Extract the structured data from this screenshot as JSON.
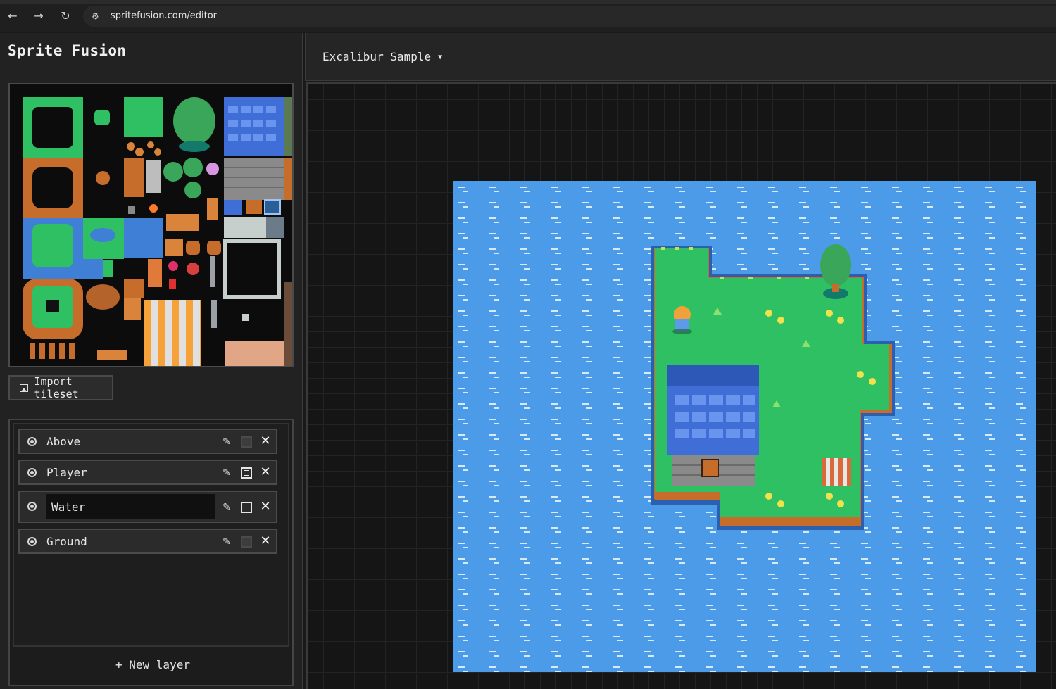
{
  "browser": {
    "url": "spritefusion.com/editor"
  },
  "app": {
    "title": "Sprite Fusion"
  },
  "tileset": {
    "import_label": "Import tileset"
  },
  "layers": {
    "items": [
      {
        "name": "Above",
        "visible_toggle": "off"
      },
      {
        "name": "Player",
        "visible_toggle": "on"
      },
      {
        "name": "Water",
        "visible_toggle": "on",
        "editing": true
      },
      {
        "name": "Ground",
        "visible_toggle": "off"
      }
    ],
    "new_layer_label": "+ New layer"
  },
  "map": {
    "selected_map": "Excalibur Sample"
  },
  "colors": {
    "water": "#4c9be8",
    "grass": "#2fc064",
    "roof": "#3f6fd6",
    "background": "#151515"
  }
}
